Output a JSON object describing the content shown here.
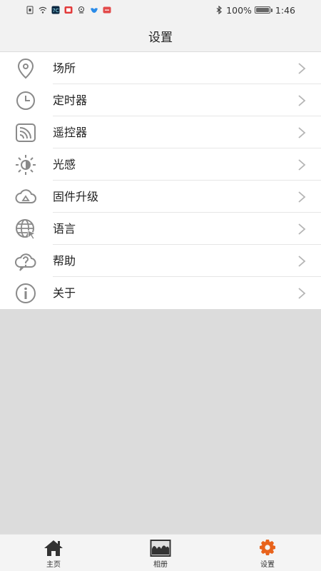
{
  "status_bar": {
    "battery": "100%",
    "time": "1:46",
    "bluetooth_icon": "bluetooth-icon",
    "left_icons": [
      "sim-icon",
      "wifi-icon",
      "app-icon",
      "app-icon",
      "location-icon",
      "bird-icon",
      "app-icon"
    ]
  },
  "header": {
    "title": "设置"
  },
  "settings": {
    "items": [
      {
        "label": "场所",
        "icon": "location-pin-icon"
      },
      {
        "label": "定时器",
        "icon": "clock-icon"
      },
      {
        "label": "遥控器",
        "icon": "remote-icon"
      },
      {
        "label": "光感",
        "icon": "light-sensor-icon"
      },
      {
        "label": "固件升级",
        "icon": "cloud-upload-icon"
      },
      {
        "label": "语言",
        "icon": "globe-icon"
      },
      {
        "label": "帮助",
        "icon": "help-cloud-icon"
      },
      {
        "label": "关于",
        "icon": "info-icon"
      }
    ]
  },
  "tabs": [
    {
      "label": "主页",
      "icon": "home-icon",
      "active": false
    },
    {
      "label": "相册",
      "icon": "album-icon",
      "active": false
    },
    {
      "label": "设置",
      "icon": "gear-icon",
      "active": true
    }
  ],
  "colors": {
    "active_tab": "#e8631c",
    "icon_gray": "#8a8a8a",
    "background": "#dcdcdc"
  }
}
